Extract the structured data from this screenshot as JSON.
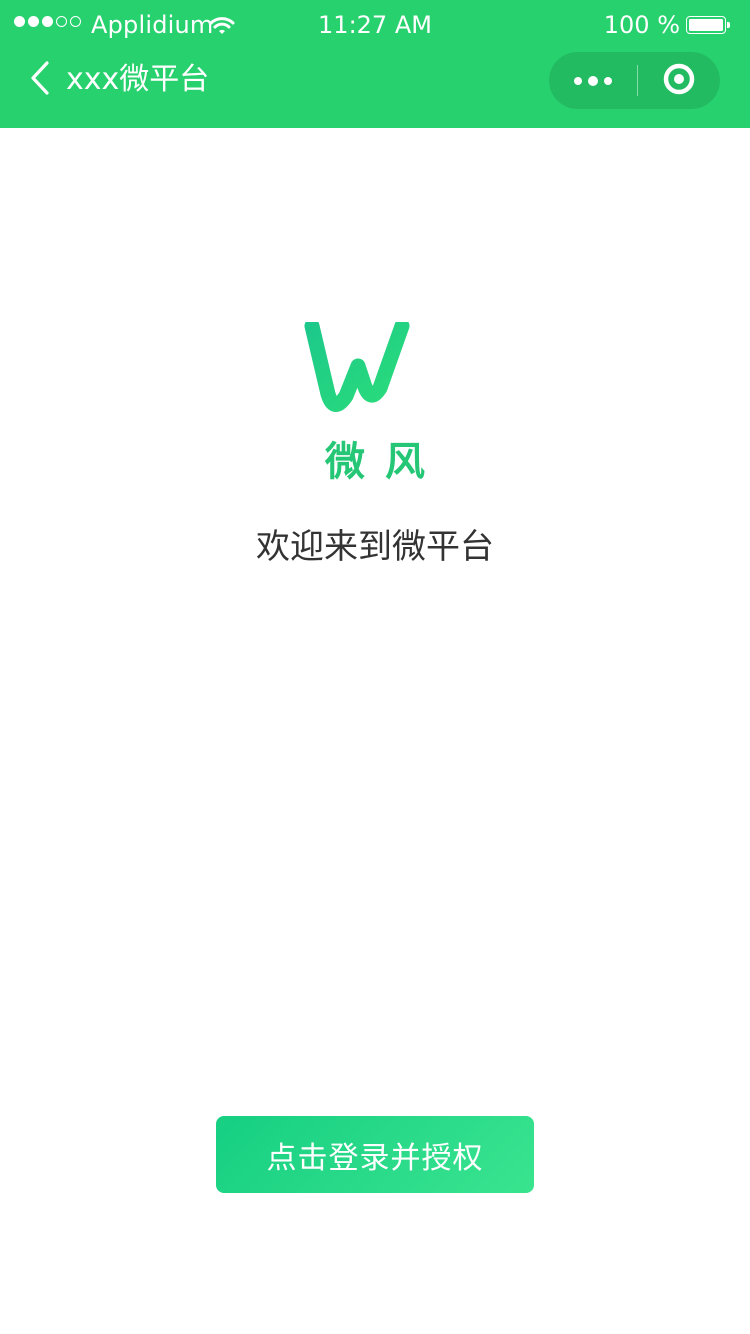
{
  "status_bar": {
    "signal_dots": [
      "full",
      "full",
      "full",
      "empty",
      "empty"
    ],
    "carrier": "Applidium",
    "time": "11:27 AM",
    "battery_text": "100 %",
    "battery_level": 1.0
  },
  "nav_bar": {
    "back_icon": "chevron-left-icon",
    "title": "xxx微平台",
    "capsule": {
      "more_icon": "more-dots-icon",
      "close_icon": "target-circle-icon"
    }
  },
  "logo": {
    "mark_icon": "wf-logo",
    "text": "微风"
  },
  "welcome_text": "欢迎来到微平台",
  "login_button": {
    "label": "点击登录并授权"
  },
  "colors": {
    "header_bg": "#27d16e",
    "brand_green": "#25c776",
    "button_gradient_start": "#16cf82",
    "button_gradient_end": "#3ae48f",
    "text_dark": "#333333",
    "page_bg": "#ffffff"
  }
}
